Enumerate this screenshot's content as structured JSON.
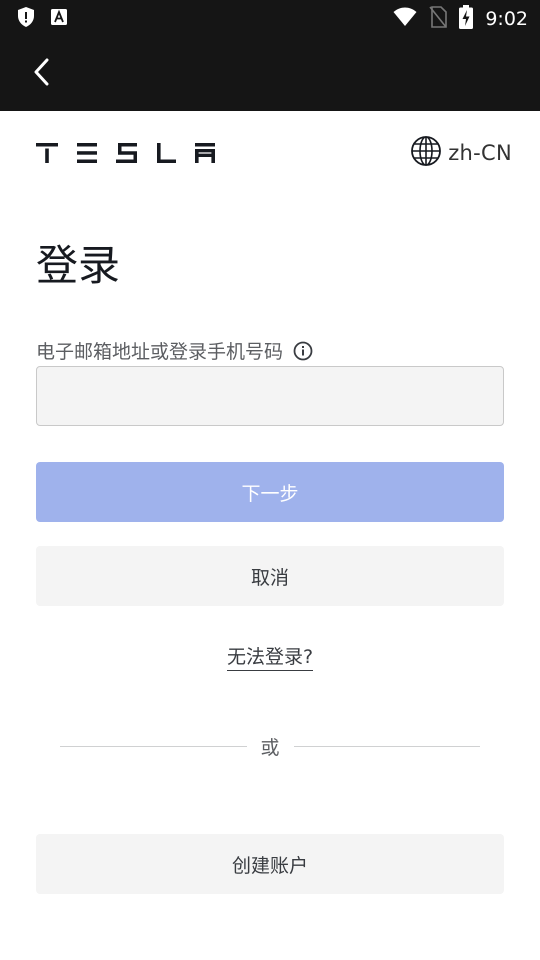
{
  "status_bar": {
    "time": "9:02",
    "icons": [
      "shield-icon",
      "font-a-icon",
      "wifi-icon",
      "no-sim-icon",
      "battery-charging-icon"
    ]
  },
  "app_bar": {
    "back_icon": "chevron-left-icon"
  },
  "header": {
    "logo": "TESLA",
    "language": "zh-CN",
    "language_icon": "globe-icon"
  },
  "login": {
    "title": "登录",
    "email_label": "电子邮箱地址或登录手机号码",
    "email_value": "",
    "email_placeholder": "",
    "next_label": "下一步",
    "cancel_label": "取消",
    "cant_login_label": "无法登录?",
    "or_label": "或",
    "create_account_label": "创建账户"
  },
  "colors": {
    "status_bar_bg": "#151515",
    "primary_disabled": "#9fb2ec",
    "secondary_bg": "#f4f4f4",
    "text_dark": "#171a20"
  }
}
